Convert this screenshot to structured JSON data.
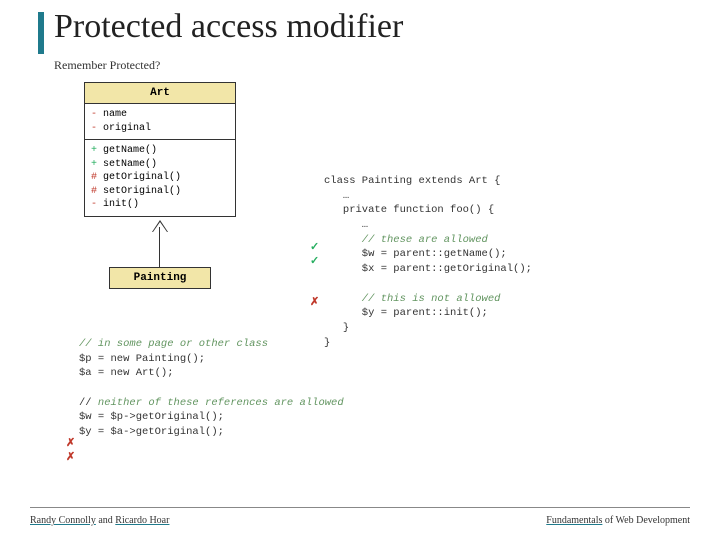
{
  "title": "Protected access modifier",
  "subtitle": "Remember Protected?",
  "uml": {
    "art": {
      "name": "Art",
      "attrs": [
        {
          "vis": "-",
          "text": "name"
        },
        {
          "vis": "-",
          "text": "original"
        }
      ],
      "ops": [
        {
          "vis": "+",
          "text": "getName()"
        },
        {
          "vis": "+",
          "text": "setName()"
        },
        {
          "vis": "#",
          "text": "getOriginal()"
        },
        {
          "vis": "#",
          "text": "setOriginal()"
        },
        {
          "vis": "-",
          "text": "init()"
        }
      ]
    },
    "painting": {
      "name": "Painting"
    }
  },
  "code_right": {
    "l1": "class Painting extends Art {",
    "l2": "   …",
    "l3": "   private function foo() {",
    "l4": "      …",
    "l5_comment": "      // these are allowed",
    "l6": "      $w = parent::getName();",
    "l7": "      $x = parent::getOriginal();",
    "l8": "",
    "l9_comment": "      // this is not allowed",
    "l10": "      $y = parent::init();",
    "l11": "   }",
    "l12": "}"
  },
  "code_bottom": {
    "l1_comment": "// in some page or other class",
    "l2": "$p = new Painting();",
    "l3": "$a = new Art();",
    "l4": "",
    "l5a": "// ",
    "l5b_comment": "neither of these references are allowed",
    "l6": "$w = $p->getOriginal();",
    "l7": "$y = $a->getOriginal();"
  },
  "marks": {
    "check": "✓",
    "cross": "✗"
  },
  "footer": {
    "left_a": "Randy Connolly",
    "left_mid": " and ",
    "left_b": "Ricardo Hoar",
    "right_a": "Fundamentals",
    "right_b": " of Web Development"
  }
}
